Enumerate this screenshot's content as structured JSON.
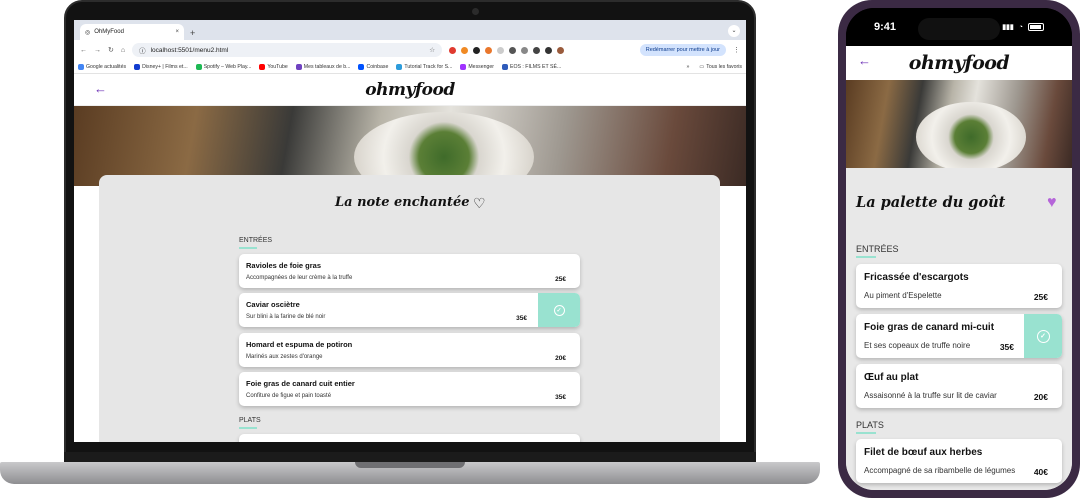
{
  "laptop": {
    "browser": {
      "tab_title": "OhMyFood",
      "tab_close": "×",
      "new_tab": "+",
      "tab_menu": "⌄",
      "url": "localhost:5501/menu2.html",
      "restart_label": "Redémarrer pour mettre à jour",
      "bookmarks": [
        "Google actualités",
        "Disney+ | Films et...",
        "Spotify – Web Play...",
        "YouTube",
        "Mes tableaux de b...",
        "Coinbase",
        "Tutorial Track for S...",
        "Messenger",
        "EOS : FILMS ET SÉ..."
      ],
      "bookmarks_more": "»",
      "all_bookmarks": "Tous les favoris"
    },
    "site": {
      "logo": "ohmyfood",
      "menu_title": "La note enchantée",
      "sections": [
        {
          "title": "ENTRÉES",
          "items": [
            {
              "name": "Ravioles de foie gras",
              "desc": "Accompagnées de leur crème à la truffe",
              "price": "25€",
              "selected": false
            },
            {
              "name": "Caviar osciètre",
              "desc": "Sur blini à la farine de blé noir",
              "price": "35€",
              "selected": true
            },
            {
              "name": "Homard et espuma de potiron",
              "desc": "Marinés aux zestes d'orange",
              "price": "20€",
              "selected": false
            },
            {
              "name": "Foie gras de canard cuit entier",
              "desc": "Confiture de figue et pain toasté",
              "price": "35€",
              "selected": false
            }
          ]
        },
        {
          "title": "PLATS"
        }
      ]
    }
  },
  "phone": {
    "time": "9:41",
    "logo": "ohmyfood",
    "menu_title": "La palette du goût",
    "sections": [
      {
        "title": "ENTRÉES",
        "items": [
          {
            "name": "Fricassée d'escargots",
            "desc": "Au piment d'Espelette",
            "price": "25€",
            "selected": false
          },
          {
            "name": "Foie gras de canard mi-cuit",
            "desc": "Et ses copeaux de truffe noire",
            "price": "35€",
            "selected": true
          },
          {
            "name": "Œuf au plat",
            "desc": "Assaisonné à la truffe sur lit de caviar",
            "price": "20€",
            "selected": false
          }
        ]
      },
      {
        "title": "PLATS",
        "items": [
          {
            "name": "Filet de bœuf aux herbes",
            "desc": "Accompagné de sa ribambelle de légumes",
            "price": "40€",
            "selected": false
          }
        ]
      }
    ]
  },
  "icons": {
    "back": "←",
    "check": "✓",
    "heart_outline": "♡",
    "heart_filled": "♥"
  },
  "colors": {
    "accent_purple": "#6b2fb5",
    "mint": "#99e2d0",
    "heart_filled": "#b565d9"
  }
}
